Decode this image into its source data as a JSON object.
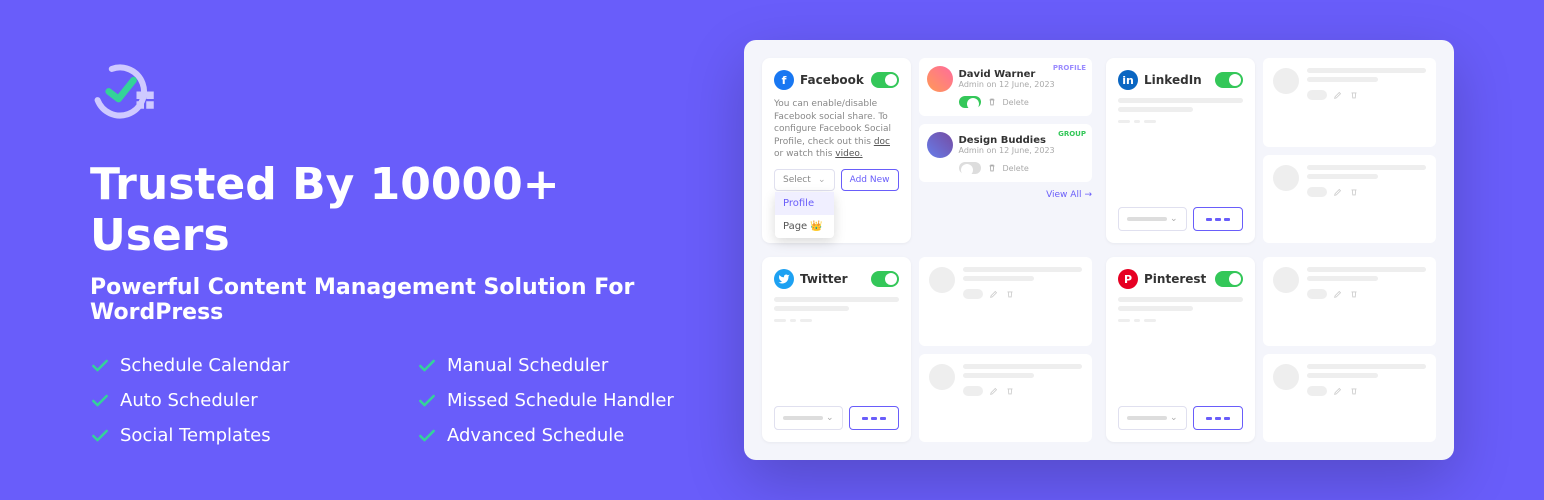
{
  "hero": {
    "title": "Trusted By 10000+ Users",
    "subtitle": "Powerful Content Management Solution For WordPress",
    "features": [
      "Schedule Calendar",
      "Manual Scheduler",
      "Auto Scheduler",
      "Missed Schedule Handler",
      "Social Templates",
      "Advanced Schedule"
    ]
  },
  "dashboard": {
    "facebook": {
      "title": "Facebook",
      "desc_pre": "You can enable/disable Facebook social share. To configure Facebook Social Profile, check out this ",
      "desc_doc": "doc",
      "desc_mid": " or watch this ",
      "desc_video": "video.",
      "select_label": "Select",
      "add_new": "Add New",
      "dropdown": {
        "profile": "Profile",
        "page": "Page"
      },
      "users": [
        {
          "name": "David Warner",
          "meta": "Admin on 12 June, 2023",
          "badge": "PROFILE",
          "delete": "Delete"
        },
        {
          "name": "Design Buddies",
          "meta": "Admin on 12 June, 2023",
          "badge": "GROUP",
          "delete": "Delete"
        }
      ],
      "view_all": "View All"
    },
    "linkedin": {
      "title": "LinkedIn"
    },
    "twitter": {
      "title": "Twitter"
    },
    "pinterest": {
      "title": "Pinterest"
    }
  }
}
